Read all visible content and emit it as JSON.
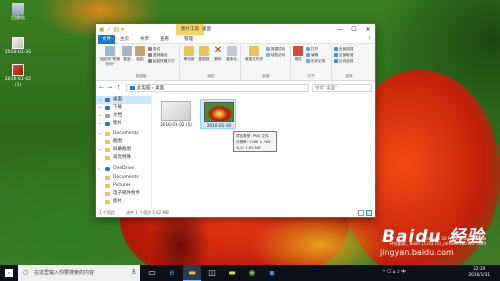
{
  "desktop": {
    "icons": [
      {
        "label": "回收站",
        "icon": "recycle-bin-icon"
      },
      {
        "label": "2016-01-30",
        "icon": "png-file-icon"
      },
      {
        "label": "2016-01-02 (5)",
        "icon": "png-file-icon"
      }
    ]
  },
  "window": {
    "quick_access_icons": "▣ ✓ ▤ ▾",
    "context_group": "图片工具",
    "title": "桌面",
    "controls": {
      "minimize": "—",
      "maximize": "☐",
      "close": "✕",
      "help": "?"
    },
    "tabs": [
      "文件",
      "主页",
      "共享",
      "查看",
      "管理"
    ],
    "ribbon": {
      "pin_label": "固定到\"快速访问\"",
      "copy_label": "复制",
      "paste_label": "粘贴",
      "cut_label": "剪切",
      "copy_path_label": "复制路径",
      "paste_shortcut_label": "粘贴快捷方式",
      "clipboard_group": "剪贴板",
      "move_to_label": "移动到",
      "copy_to_label": "复制到",
      "delete_label": "删除",
      "rename_label": "重命名",
      "organize_group": "组织",
      "new_folder_label": "新建文件夹",
      "new_group": "新建",
      "properties_label": "属性",
      "open_label": "打开",
      "edit_label": "编辑",
      "history_label": "历史记录",
      "open_group": "打开",
      "select_all_label": "全部选择",
      "select_none_label": "全部取消",
      "invert_label": "反向选择",
      "select_group": "选择",
      "new_item_label": "新建项目",
      "easy_access_label": "轻松访问"
    },
    "address": {
      "path": "此电脑 › 桌面",
      "search_placeholder": "搜索\"桌面\""
    },
    "nav_items": [
      {
        "label": "桌面",
        "color": "#2b78c8"
      },
      {
        "label": "下载",
        "color": "#2b78c8"
      },
      {
        "label": "文档",
        "color": "#9aa4ad"
      },
      {
        "label": "图片",
        "color": "#2b78c8"
      },
      {
        "label": "Documents",
        "color": "#e8c25a"
      },
      {
        "label": "截图",
        "color": "#e8c25a"
      },
      {
        "label": "屏幕截图",
        "color": "#e8c25a"
      },
      {
        "label": "高亮特殊",
        "color": "#e8c25a"
      },
      {
        "label": "OneDrive",
        "color": "#2b78c8"
      },
      {
        "label": "Documents",
        "color": "#e8c25a"
      },
      {
        "label": "Pictures",
        "color": "#e8c25a"
      },
      {
        "label": "电子邮件附件",
        "color": "#e8c25a"
      },
      {
        "label": "图片",
        "color": "#e8c25a"
      }
    ],
    "files": [
      {
        "name": "2016-01-02 (5)"
      },
      {
        "name": "2016-01-30"
      }
    ],
    "tooltip": {
      "type": "项目类型: PNG 文件",
      "dimensions": "分辨率: 1366 × 768",
      "size": "大小: 1.62 MB"
    },
    "status": {
      "count": "2 个项目",
      "selected": "选中 1 个项目  1.62 MB"
    }
  },
  "taskbar": {
    "search_placeholder": "在这里输入你要搜索的内容",
    "tray_text": "^ ☐ ⌂ ♪ 中",
    "time": "22:20",
    "date": "2016/1/31"
  },
  "watermark": {
    "build_line1": "Windows 10 Pro Insider Preview",
    "build_line2": "评估副本。Build 11102.rs1_release.160113-1800",
    "logo": "Baidu 经验",
    "url": "jingyan.baidu.com"
  }
}
